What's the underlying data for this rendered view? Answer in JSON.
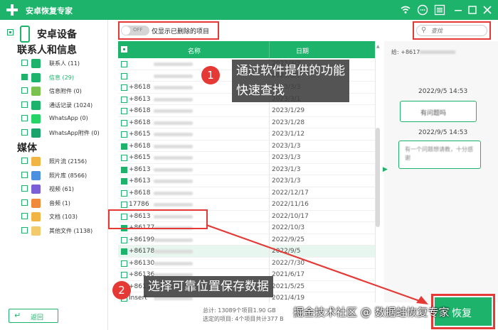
{
  "app": {
    "title": "安卓恢复专家"
  },
  "titlebar": {
    "icons": [
      "wifi-icon",
      "chat-icon",
      "menu-icon",
      "minimize-icon",
      "maximize-icon",
      "close-icon"
    ]
  },
  "sidebar": {
    "device_label": "安卓设备",
    "section_contacts": "联系人和信息",
    "section_media": "媒体",
    "categories_contacts": [
      {
        "label": "联系人 (11)",
        "icon": "contacts-icon",
        "color": "#1eb36b",
        "checked": false
      },
      {
        "label": "信息 (29)",
        "icon": "message-icon",
        "color": "#1eb36b",
        "checked": true,
        "active": true
      },
      {
        "label": "信息附件 (0)",
        "icon": "attachment-icon",
        "color": "#7cc24f",
        "checked": false
      },
      {
        "label": "通话记录 (1024)",
        "icon": "call-log-icon",
        "color": "#1eb36b",
        "checked": false
      },
      {
        "label": "WhatsApp (0)",
        "icon": "whatsapp-icon",
        "color": "#25d366",
        "checked": false
      },
      {
        "label": "WhatsApp附件 (0)",
        "icon": "whatsapp-attachment-icon",
        "color": "#1aa36b",
        "checked": false
      }
    ],
    "categories_media": [
      {
        "label": "照片流 (2156)",
        "icon": "photo-stream-icon",
        "color": "#f2b544",
        "checked": false
      },
      {
        "label": "照片库 (8566)",
        "icon": "photo-library-icon",
        "color": "#4a8fe0",
        "checked": false
      },
      {
        "label": "视频 (61)",
        "icon": "video-icon",
        "color": "#7b5fd6",
        "checked": false
      },
      {
        "label": "音频 (1)",
        "icon": "audio-icon",
        "color": "#f08a3a",
        "checked": false
      },
      {
        "label": "文档 (103)",
        "icon": "document-icon",
        "color": "#f2b544",
        "checked": false
      },
      {
        "label": "其他文件 (1138)",
        "icon": "other-files-icon",
        "color": "#f2c96b",
        "checked": false
      }
    ],
    "back_label": "返回"
  },
  "toolbar": {
    "toggle_text": "OFF",
    "toggle_label": "仅显示已删除的项目",
    "search_placeholder": "查找"
  },
  "table": {
    "col_name": "名称",
    "col_date": "日期",
    "rows": [
      {
        "num": "",
        "date": "2023/3/3",
        "checked": false
      },
      {
        "num": "",
        "date": "2023/3/3",
        "checked": false
      },
      {
        "num": "+8618",
        "date": "2023/3/3",
        "checked": false
      },
      {
        "num": "+8613",
        "date": "2023/3/1",
        "checked": false
      },
      {
        "num": "+8618",
        "date": "2023/1/29",
        "checked": false
      },
      {
        "num": "+8618",
        "date": "2023/1/28",
        "checked": false
      },
      {
        "num": "+8615",
        "date": "2023/1/12",
        "checked": false
      },
      {
        "num": "+8618",
        "date": "2023/1/3",
        "checked": true
      },
      {
        "num": "+8615",
        "date": "2023/1/3",
        "checked": false
      },
      {
        "num": "+8613",
        "date": "2023/1/3",
        "checked": true
      },
      {
        "num": "+8613",
        "date": "2023/1/3",
        "checked": true
      },
      {
        "num": "+8618",
        "date": "2022/12/17",
        "checked": false
      },
      {
        "num": "17786",
        "date": "2022/11/16",
        "checked": false
      },
      {
        "num": "+8613",
        "date": "2022/10/17",
        "checked": false
      },
      {
        "num": "+86177",
        "date": "2022/10/3",
        "checked": true,
        "boxed": true
      },
      {
        "num": "+86199",
        "date": "2022/9/25",
        "checked": false
      },
      {
        "num": "+86178",
        "date": "2022/9/5",
        "checked": true,
        "highlight": true
      },
      {
        "num": "+86130",
        "date": "2022/7/30",
        "checked": false
      },
      {
        "num": "+86136",
        "date": "2021/6/17",
        "checked": false
      },
      {
        "num": "+86132",
        "date": "2021/5/25",
        "checked": false
      },
      {
        "num": "Insert",
        "date": "2021/4/19",
        "checked": false
      }
    ]
  },
  "footer": {
    "total": "总计: 13089个项目1.90 GB",
    "selected": "选定的项目: 4个项目共计377 B"
  },
  "preview": {
    "to_label": "给: +8617",
    "messages": [
      {
        "time": "2022/9/5 14:53",
        "bubble": "有问题吗"
      },
      {
        "time": "2022/9/5 14:53",
        "bubble": "有一个问题想请教，十分感谢"
      }
    ]
  },
  "annotations": {
    "step1_num": "1",
    "step1_text_line1": "通过软件提供的功能",
    "step1_text_line2": "快速查找",
    "step2_num": "2",
    "step2_text": "选择可靠位置保存数据"
  },
  "recover_label": "恢复",
  "watermark": "掘金技术社区 @ 数据蛙恢复专家"
}
